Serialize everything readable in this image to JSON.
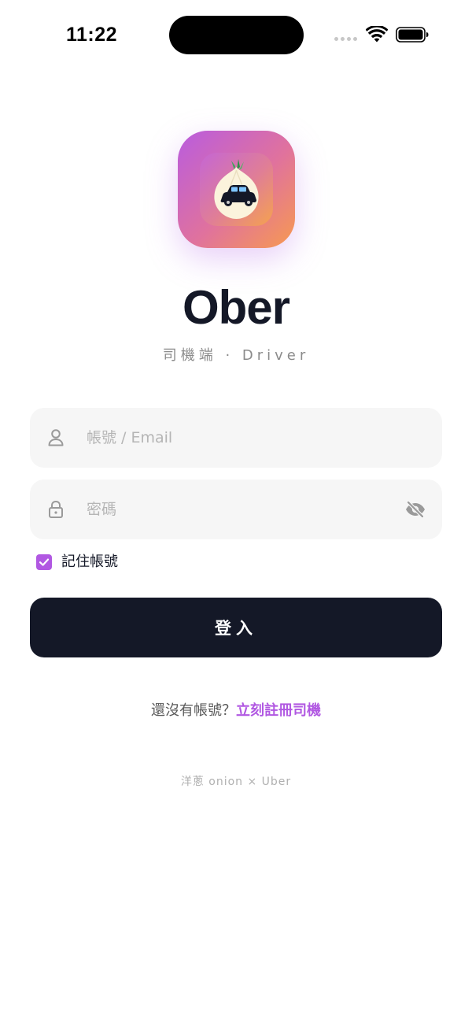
{
  "status_bar": {
    "time": "11:22"
  },
  "app": {
    "name": "Ober",
    "subtitle": "司機端 · Driver",
    "icon": "onion-taxi-logo"
  },
  "login_form": {
    "username_placeholder": "帳號 / Email",
    "username_value": "",
    "username_icon": "user-icon",
    "password_placeholder": "密碼",
    "password_value": "",
    "password_icon": "lock-icon",
    "visibility_icon": "eye-off-icon",
    "remember_label": "記住帳號",
    "remember_checked": true,
    "submit_label": "登入"
  },
  "register": {
    "prompt": "還沒有帳號？",
    "link_label": "立刻註冊司機"
  },
  "footer": {
    "text": "洋蔥 onion × Uber"
  },
  "colors": {
    "primary_dark": "#141827",
    "accent": "#b158e2",
    "field_bg": "#f6f6f6",
    "icon_gradient_start": "#b95cdf",
    "icon_gradient_end": "#f79a50"
  }
}
